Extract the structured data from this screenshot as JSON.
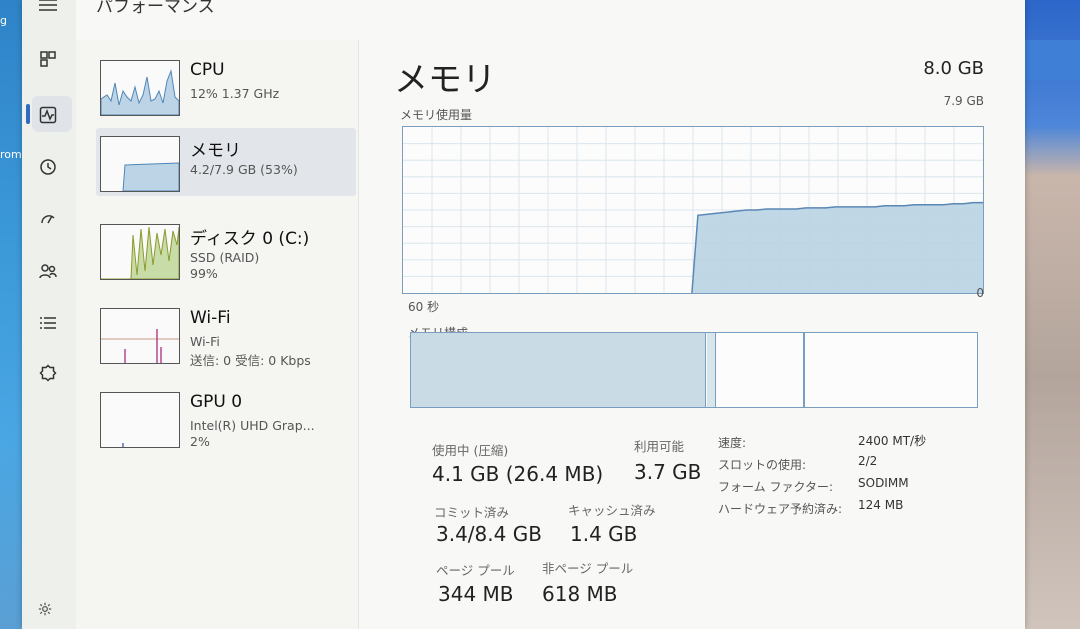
{
  "app": {
    "page_title": "パフォーマンス"
  },
  "desktop": {
    "left_fragment_1": "g",
    "left_fragment_2": "rom"
  },
  "nav": {
    "icons": [
      "menu-icon",
      "apps-icon",
      "performance-icon",
      "history-icon",
      "startup-icon",
      "users-icon",
      "details-icon",
      "services-icon"
    ]
  },
  "sidebar": {
    "items": [
      {
        "name": "CPU",
        "sub": "12%  1.37 GHz",
        "sub2": ""
      },
      {
        "name": "メモリ",
        "sub": "4.2/7.9 GB (53%)",
        "sub2": ""
      },
      {
        "name": "ディスク 0 (C:)",
        "sub": "SSD (RAID)",
        "sub2": "99%"
      },
      {
        "name": "Wi-Fi",
        "sub": "Wi-Fi",
        "sub2": "送信: 0 受信: 0 Kbps"
      },
      {
        "name": "GPU 0",
        "sub": "Intel(R) UHD Grap...",
        "sub2": "2%"
      }
    ]
  },
  "memory": {
    "title": "メモリ",
    "total": "8.0 GB",
    "graph_label": "メモリ使用量",
    "graph_max": "7.9 GB",
    "graph_time_left": "60 秒",
    "graph_time_right": "0",
    "graph_usage_gb": [
      0,
      0,
      0,
      0,
      0,
      0,
      0,
      0,
      0,
      0,
      0,
      0,
      0,
      0,
      0,
      0,
      0,
      0,
      0,
      0,
      0,
      0,
      0,
      0,
      0,
      0,
      0,
      0,
      0,
      0,
      3.7,
      3.75,
      3.8,
      3.85,
      3.9,
      3.95,
      3.95,
      4.0,
      4.0,
      4.0,
      4.0,
      4.05,
      4.05,
      4.05,
      4.1,
      4.1,
      4.1,
      4.1,
      4.1,
      4.15,
      4.15,
      4.15,
      4.2,
      4.2,
      4.2,
      4.2,
      4.25,
      4.25,
      4.3,
      4.3
    ],
    "composition_label": "メモリ構成",
    "stats": {
      "in_use_label": "使用中 (圧縮)",
      "in_use_value": "4.1 GB (26.4 MB)",
      "available_label": "利用可能",
      "available_value": "3.7 GB",
      "committed_label": "コミット済み",
      "committed_value": "3.4/8.4 GB",
      "cached_label": "キャッシュ済み",
      "cached_value": "1.4 GB",
      "paged_label": "ページ プール",
      "paged_value": "344 MB",
      "nonpaged_label": "非ページ プール",
      "nonpaged_value": "618 MB"
    },
    "details": {
      "speed_label": "速度:",
      "speed_value": "2400 MT/秒",
      "slots_label": "スロットの使用:",
      "slots_value": "2/2",
      "form_label": "フォーム ファクター:",
      "form_value": "SODIMM",
      "reserved_label": "ハードウェア予約済み:",
      "reserved_value": "124 MB"
    }
  },
  "colors": {
    "accent": "#2f6bc2",
    "memory_fill": "#b9d3e3",
    "memory_line": "#5a87b4",
    "grid": "#dbe6ec"
  }
}
